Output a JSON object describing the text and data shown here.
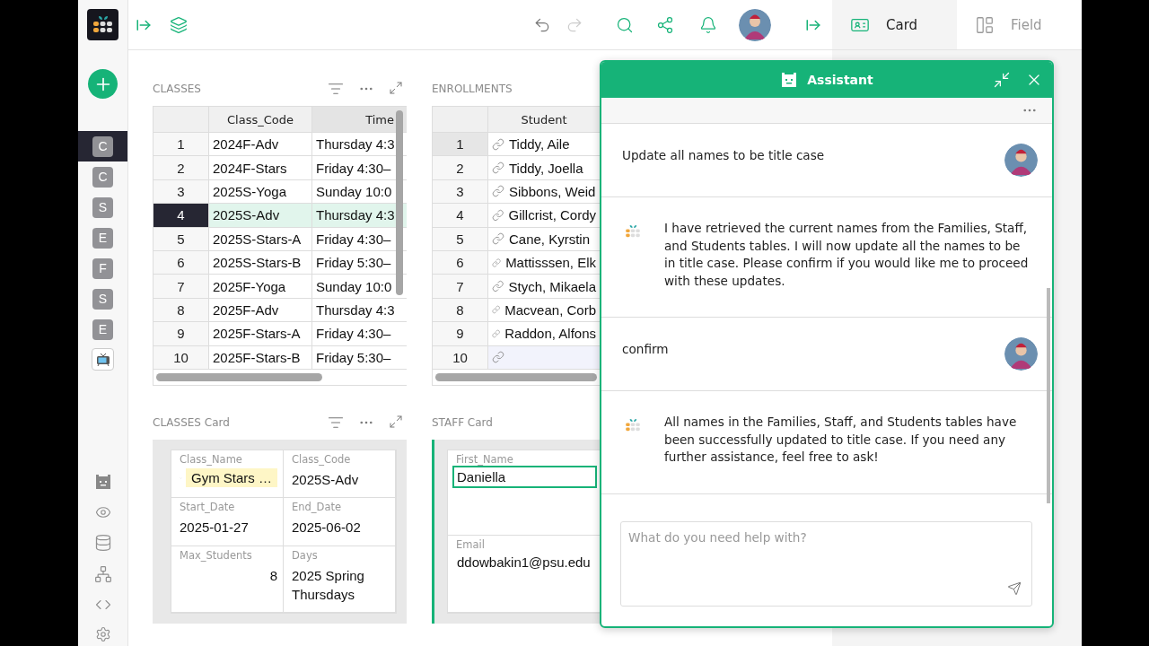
{
  "sidebar": {
    "items": [
      {
        "letter": "C",
        "selected": true
      },
      {
        "letter": "C",
        "selected": false
      },
      {
        "letter": "S",
        "selected": false
      },
      {
        "letter": "E",
        "selected": false
      },
      {
        "letter": "F",
        "selected": false
      },
      {
        "letter": "S",
        "selected": false
      },
      {
        "letter": "E",
        "selected": false
      }
    ]
  },
  "right_panel": {
    "tabs": [
      {
        "label": "Card",
        "selected": true
      },
      {
        "label": "Field",
        "selected": false
      }
    ]
  },
  "classes": {
    "title": "CLASSES",
    "columns": [
      "Class_Code",
      "Time"
    ],
    "rows": [
      {
        "num": "1",
        "class_code": "2024F-Adv",
        "time": "Thursday 4:3",
        "selected": false
      },
      {
        "num": "2",
        "class_code": "2024F-Stars",
        "time": "Friday 4:30–",
        "selected": false
      },
      {
        "num": "3",
        "class_code": "2025S-Yoga",
        "time": "Sunday 10:0",
        "selected": false
      },
      {
        "num": "4",
        "class_code": "2025S-Adv",
        "time": "Thursday 4:3",
        "selected": true
      },
      {
        "num": "5",
        "class_code": "2025S-Stars-A",
        "time": "Friday 4:30–",
        "selected": false
      },
      {
        "num": "6",
        "class_code": "2025S-Stars-B",
        "time": "Friday 5:30–",
        "selected": false
      },
      {
        "num": "7",
        "class_code": "2025F-Yoga",
        "time": "Sunday 10:0",
        "selected": false
      },
      {
        "num": "8",
        "class_code": "2025F-Adv",
        "time": "Thursday 4:3",
        "selected": false
      },
      {
        "num": "9",
        "class_code": "2025F-Stars-A",
        "time": "Friday 4:30–",
        "selected": false
      },
      {
        "num": "10",
        "class_code": "2025F-Stars-B",
        "time": "Friday 5:30–",
        "selected": false
      }
    ]
  },
  "enrollments": {
    "title": "ENROLLMENTS",
    "columns": [
      "Student"
    ],
    "rows": [
      {
        "num": "1",
        "student": "Tiddy, Aile",
        "kind": "record",
        "selected": true
      },
      {
        "num": "2",
        "student": "Tiddy, Joella",
        "kind": "record",
        "selected": false
      },
      {
        "num": "3",
        "student": "Sibbons, Weid",
        "kind": "record",
        "selected": false
      },
      {
        "num": "4",
        "student": "Gillcrist, Cordy",
        "kind": "record",
        "selected": false
      },
      {
        "num": "5",
        "student": "Cane, Kyrstin",
        "kind": "record",
        "selected": false
      },
      {
        "num": "6",
        "student": "Mattisssen, Elk",
        "kind": "record",
        "selected": false
      },
      {
        "num": "7",
        "student": "Stych, Mikaela",
        "kind": "record",
        "selected": false
      },
      {
        "num": "8",
        "student": "Macvean, Corb",
        "kind": "record",
        "selected": false
      },
      {
        "num": "9",
        "student": "Raddon, Alfons",
        "kind": "record",
        "selected": false
      },
      {
        "num": "10",
        "kind": "new",
        "selected": false
      }
    ]
  },
  "classes_card": {
    "title": "CLASSES Card",
    "fields": [
      {
        "label": "Class_Name",
        "value": "Gym Stars …",
        "kind": "choice"
      },
      {
        "label": "Class_Code",
        "value": "2025S-Adv",
        "kind": "text"
      },
      {
        "label": "Start_Date",
        "value": "2025-01-27",
        "kind": "text"
      },
      {
        "label": "End_Date",
        "value": "2025-06-02",
        "kind": "text"
      },
      {
        "label": "Max_Students",
        "value": "8",
        "kind": "number"
      },
      {
        "label": "Days",
        "value": "2025 Spring Thursdays",
        "kind": "text"
      }
    ]
  },
  "staff_card": {
    "title": "STAFF Card",
    "fields": [
      {
        "label": "First_Name",
        "value": "Daniella",
        "selected": true
      },
      {
        "label": "Email",
        "value": "ddowbakin1@psu.edu",
        "selected": false
      }
    ]
  },
  "assistant": {
    "title": "Assistant",
    "messages": [
      {
        "kind": "user",
        "text": "Update all names to be title case"
      },
      {
        "kind": "assistant",
        "text": "I have retrieved the current names from the Families, Staff, and Students tables. I will now update all the names to be in title case. Please confirm if you would like me to proceed with these updates."
      },
      {
        "kind": "user",
        "text": "confirm"
      },
      {
        "kind": "assistant",
        "text": "All names in the Families, Staff, and Students tables have been successfully updated to title case. If you need any further assistance, feel free to ask!"
      }
    ],
    "input": {
      "placeholder": "What do you need help with?"
    }
  }
}
